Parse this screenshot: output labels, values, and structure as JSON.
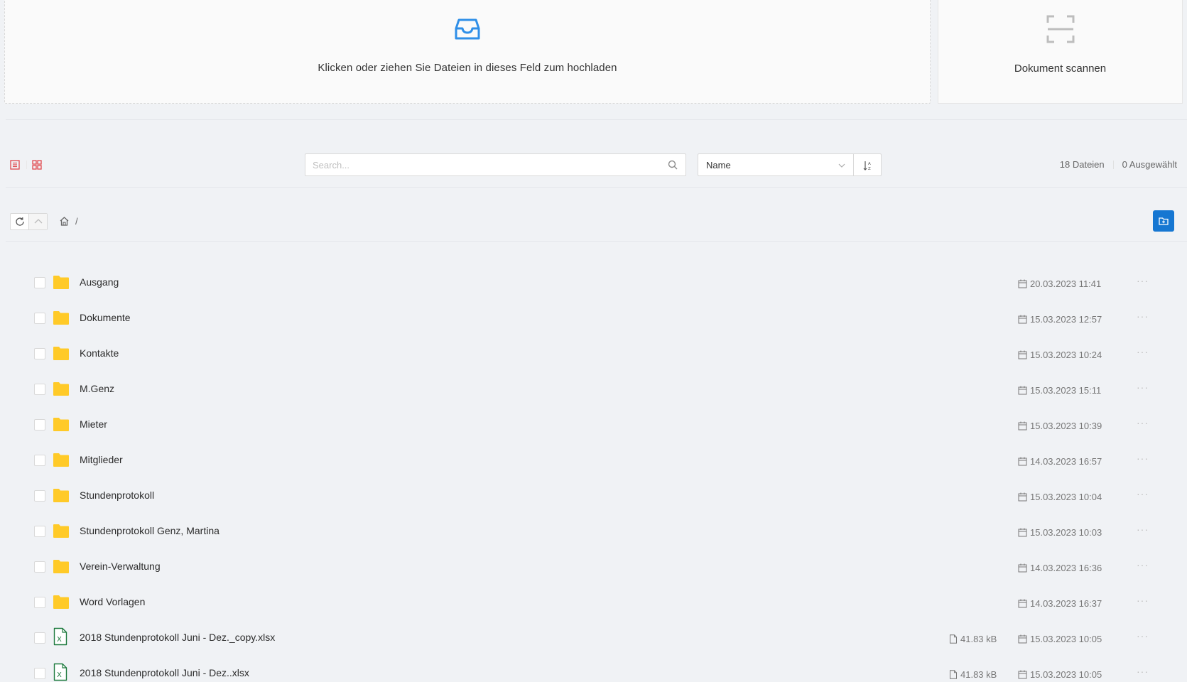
{
  "upload": {
    "text": "Klicken oder ziehen Sie Dateien in dieses Feld zum hochladen",
    "icon": "inbox-icon"
  },
  "scan": {
    "label": "Dokument scannen",
    "icon": "scan-icon"
  },
  "toolbar": {
    "search_placeholder": "Search...",
    "sort_value": "Name",
    "file_count": "18 Dateien",
    "selected_count": "0 Ausgewählt"
  },
  "breadcrumb": {
    "separator": "/"
  },
  "colors": {
    "accent": "#1677d2",
    "folder": "#ffca28",
    "excel": "#1d7a3e",
    "view_icon": "#e0474c"
  },
  "items": [
    {
      "type": "folder",
      "name": "Ausgang",
      "size": "",
      "date": "20.03.2023 11:41"
    },
    {
      "type": "folder",
      "name": "Dokumente",
      "size": "",
      "date": "15.03.2023 12:57"
    },
    {
      "type": "folder",
      "name": "Kontakte",
      "size": "",
      "date": "15.03.2023 10:24"
    },
    {
      "type": "folder",
      "name": "M.Genz",
      "size": "",
      "date": "15.03.2023 15:11"
    },
    {
      "type": "folder",
      "name": "Mieter",
      "size": "",
      "date": "15.03.2023 10:39"
    },
    {
      "type": "folder",
      "name": "Mitglieder",
      "size": "",
      "date": "14.03.2023 16:57"
    },
    {
      "type": "folder",
      "name": "Stundenprotokoll",
      "size": "",
      "date": "15.03.2023 10:04"
    },
    {
      "type": "folder",
      "name": "Stundenprotokoll Genz, Martina",
      "size": "",
      "date": "15.03.2023 10:03"
    },
    {
      "type": "folder",
      "name": "Verein-Verwaltung",
      "size": "",
      "date": "14.03.2023 16:36"
    },
    {
      "type": "folder",
      "name": "Word Vorlagen",
      "size": "",
      "date": "14.03.2023 16:37"
    },
    {
      "type": "xlsx",
      "name": "2018 Stundenprotokoll Juni - Dez._copy.xlsx",
      "size": "41.83 kB",
      "date": "15.03.2023 10:05"
    },
    {
      "type": "xlsx",
      "name": "2018 Stundenprotokoll Juni - Dez..xlsx",
      "size": "41.83 kB",
      "date": "15.03.2023 10:05"
    }
  ]
}
